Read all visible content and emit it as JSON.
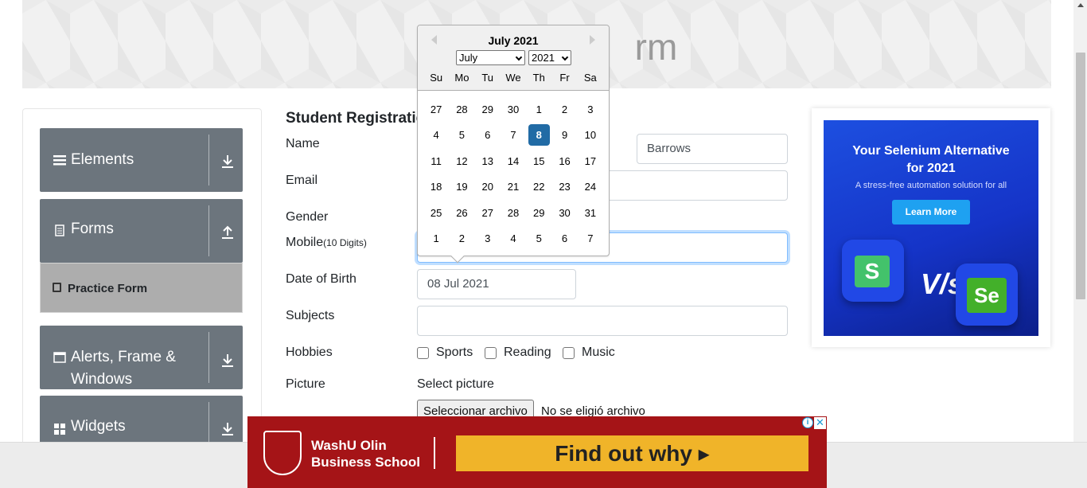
{
  "header": {
    "title_fragment": "rm"
  },
  "sidebar": {
    "groups": [
      {
        "label": "Elements",
        "icon": "hamburger-icon",
        "arrow": "download-arrow-icon"
      },
      {
        "label": "Forms",
        "icon": "document-icon",
        "arrow": "upload-arrow-icon"
      },
      {
        "label": "Alerts, Frame &",
        "label2": "Windows",
        "icon": "window-icon",
        "arrow": "download-arrow-icon"
      },
      {
        "label": "Widgets",
        "icon": "widgets-icon",
        "arrow": "download-arrow-icon"
      }
    ],
    "active_item": "Practice Form"
  },
  "form": {
    "title": "Student Registratic",
    "labels": {
      "name": "Name",
      "email": "Email",
      "gender": "Gender",
      "mobile": "Mobile",
      "mobile_hint": "(10 Digits)",
      "dob": "Date of Birth",
      "subjects": "Subjects",
      "hobbies": "Hobbies",
      "picture": "Picture"
    },
    "last_name_value": "Barrows",
    "dob_value": "08 Jul 2021",
    "hobbies": [
      "Sports",
      "Reading",
      "Music"
    ],
    "picture_label": "Select picture",
    "file_button": "Seleccionar archivo",
    "file_status": "No se eligió archivo"
  },
  "datepicker": {
    "title": "July 2021",
    "month_select": "July",
    "year_select": "2021",
    "weekdays": [
      "Su",
      "Mo",
      "Tu",
      "We",
      "Th",
      "Fr",
      "Sa"
    ],
    "weeks": [
      [
        "27",
        "28",
        "29",
        "30",
        "1",
        "2",
        "3"
      ],
      [
        "4",
        "5",
        "6",
        "7",
        "8",
        "9",
        "10"
      ],
      [
        "11",
        "12",
        "13",
        "14",
        "15",
        "16",
        "17"
      ],
      [
        "18",
        "19",
        "20",
        "21",
        "22",
        "23",
        "24"
      ],
      [
        "25",
        "26",
        "27",
        "28",
        "29",
        "30",
        "31"
      ],
      [
        "1",
        "2",
        "3",
        "4",
        "5",
        "6",
        "7"
      ]
    ],
    "selected_day": "8"
  },
  "ad_right": {
    "headline1": "Your Selenium Alternative",
    "headline2": "for 2021",
    "subline": "A stress-free automation solution for all",
    "button": "Learn More",
    "vs": "V/s",
    "tile1": "S",
    "tile2": "Se"
  },
  "ad_bottom": {
    "brand_line1": "WashU Olin",
    "brand_line2": "Business School",
    "cta": "Find out why ▸",
    "info": "i",
    "close": "✕"
  },
  "colors": {
    "sidebar_group": "#6c757d",
    "datepicker_selected": "#216ba5",
    "ad_bottom_bg": "#a51417",
    "ad_bottom_cta": "#f0b429"
  }
}
